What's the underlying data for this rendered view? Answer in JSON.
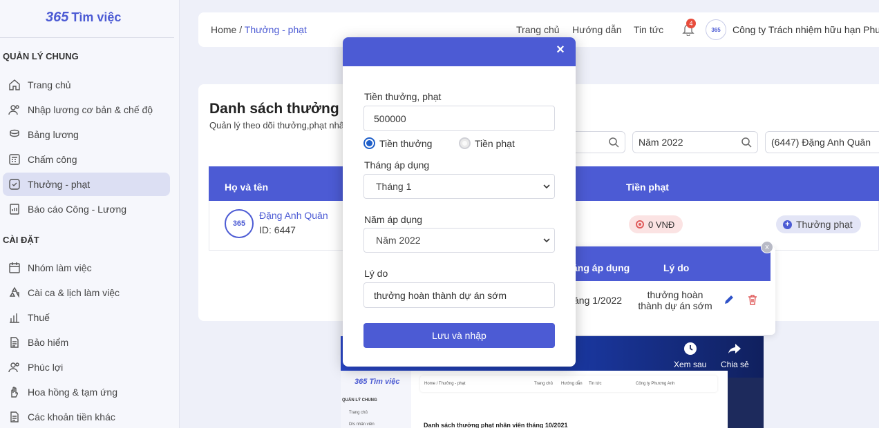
{
  "logo": {
    "mark": "365",
    "text": "Tìm việc"
  },
  "sidebar": {
    "section_general": "QUẢN LÝ CHUNG",
    "section_settings": "CÀI ĐẶT",
    "general_items": [
      {
        "label": "Trang chủ",
        "icon": "home-icon"
      },
      {
        "label": "Nhập lương cơ bản & chế độ",
        "icon": "users-icon"
      },
      {
        "label": "Bảng lương",
        "icon": "coins-icon"
      },
      {
        "label": "Chấm công",
        "icon": "calculator-icon"
      },
      {
        "label": "Thưởng - phạt",
        "icon": "check-square-icon",
        "active": true
      },
      {
        "label": "Báo cáo Công - Lương",
        "icon": "report-icon"
      }
    ],
    "settings_items": [
      {
        "label": "Nhóm làm việc",
        "icon": "calendar-icon"
      },
      {
        "label": "Cài ca & lịch làm việc",
        "icon": "recycle-icon"
      },
      {
        "label": "Thuế",
        "icon": "bar-chart-icon"
      },
      {
        "label": "Bảo hiểm",
        "icon": "document-icon"
      },
      {
        "label": "Phúc lợi",
        "icon": "users-icon"
      },
      {
        "label": "Hoa hồng & tạm ứng",
        "icon": "hand-icon"
      },
      {
        "label": "Các khoản tiền khác",
        "icon": "document-icon"
      }
    ]
  },
  "header": {
    "breadcrumb_home": "Home / ",
    "breadcrumb_current": "Thưởng - phạt",
    "nav": [
      "Trang chủ",
      "Hướng dẫn",
      "Tin tức"
    ],
    "notification_count": "4",
    "company_avatar": "365",
    "company_name": "Công ty Trách nhiệm hữu hạn Phư..."
  },
  "main": {
    "title": "Danh sách thưởng p",
    "subtitle": "Quản lý theo dõi thưởng,phạt nhâ",
    "filters": {
      "year": "Năm 2022",
      "employee": "(6447) Đặng Anh Quân"
    },
    "columns": {
      "name": "Họ và tên",
      "penalty": "Tiền phạt"
    },
    "row": {
      "avatar": "365",
      "name": "Đặng Anh Quân",
      "id": "ID: 6447",
      "penalty_value": "0 VNĐ",
      "penalty_button": "Thưởng phạt"
    }
  },
  "popover": {
    "close_label": "x",
    "col_month": "áng áp dụng",
    "col_reason": "Lý do",
    "row_month": "áng 1/2022",
    "row_reason": "thưởng hoàn thành dự án sớm"
  },
  "video": {
    "logo": "365 Tìm việc",
    "section": "QUẢN LÝ CHUNG",
    "items": [
      "Trang chủ",
      "D/s nhân viên"
    ],
    "breadcrumb": "Home / Thưởng - phạt",
    "nav": [
      "Trang chủ",
      "Hướng dẫn",
      "Tin tức"
    ],
    "company": "Công ty Phương Anh",
    "title": "Danh sách thưởng phạt nhân viên tháng 10/2021",
    "watch_later": "Xem sau",
    "share": "Chia sẻ"
  },
  "modal": {
    "close_icon": "×",
    "amount_label": "Tiền thưởng, phạt",
    "amount_value": "500000",
    "radio_bonus": "Tiền thưởng",
    "radio_penalty": "Tiền phạt",
    "month_label": "Tháng áp dụng",
    "month_value": "Tháng 1",
    "year_label": "Năm áp dụng",
    "year_value": "Năm 2022",
    "reason_label": "Lý do",
    "reason_value": "thưởng hoàn thành dự án sớm",
    "submit_label": "Lưu và nhập"
  },
  "colors": {
    "primary": "#4c5bd4",
    "radio": "#1f5fc9",
    "danger": "#e05d5d"
  }
}
